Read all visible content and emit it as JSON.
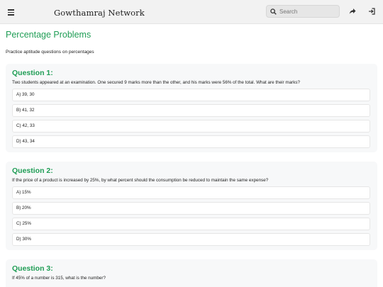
{
  "header": {
    "site_title": "Gowthamraj Network",
    "search_placeholder": "Search",
    "menu_icon": "menu-icon",
    "share_icon": "share-icon",
    "login_icon": "login-icon"
  },
  "page": {
    "title": "Percentage Problems",
    "intro": "Practice aptitude questions on percentages"
  },
  "questions": [
    {
      "title": "Question 1:",
      "text": "Two students appeared at an examination. One secured 9 marks more than the other, and his marks were 56% of the total. What are their marks?",
      "options": [
        "A) 39, 30",
        "B) 41, 32",
        "C) 42, 33",
        "D) 43, 34"
      ]
    },
    {
      "title": "Question 2:",
      "text": "If the price of a product is increased by 25%, by what percent should the consumption be reduced to maintain the same expense?",
      "options": [
        "A) 15%",
        "B) 20%",
        "C) 25%",
        "D) 30%"
      ]
    },
    {
      "title": "Question 3:",
      "text": "If 45% of a number is 315, what is the number?",
      "options": []
    }
  ],
  "colors": {
    "accent": "#1f9d55",
    "header_bg": "#f2f2f2",
    "card_bg": "#f7f8f9"
  }
}
